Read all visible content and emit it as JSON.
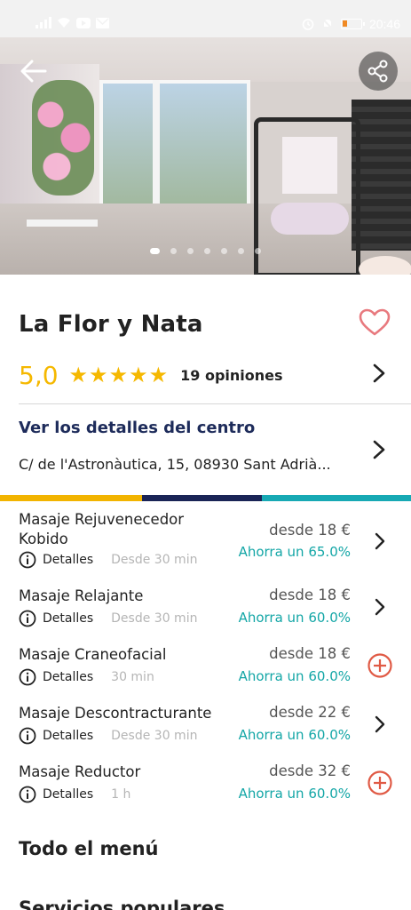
{
  "status_bar": {
    "time": "20:46",
    "battery_level": 0.2
  },
  "carousel": {
    "slide_count": 7,
    "active_index": 0
  },
  "business": {
    "name": "La Flor y Nata",
    "rating": "5,0",
    "stars": 5,
    "reviews_label": "19 opiniones",
    "details_label": "Ver los detalles del centro",
    "address": "C/ de l'Astronàutica, 15, 08930 Sant Adrià..."
  },
  "colors": {
    "accent_yellow": "#f2b400",
    "accent_navy": "#1a2456",
    "accent_teal": "#17a9b4",
    "add_button": "#e05a45",
    "heart": "#e8797e"
  },
  "services": [
    {
      "name": "Masaje Rejuvenecedor Kobido",
      "detail_label": "Detalles",
      "duration": "Desde 30 min",
      "price": "desde 18 €",
      "saving": "Ahorra un 65.0%",
      "action": "chevron"
    },
    {
      "name": "Masaje Relajante",
      "detail_label": "Detalles",
      "duration": "Desde 30 min",
      "price": "desde 18 €",
      "saving": "Ahorra un 60.0%",
      "action": "chevron"
    },
    {
      "name": "Masaje Craneofacial",
      "detail_label": "Detalles",
      "duration": "30 min",
      "price": "desde 18 €",
      "saving": "Ahorra un 60.0%",
      "action": "add"
    },
    {
      "name": "Masaje Descontracturante",
      "detail_label": "Detalles",
      "duration": "Desde 30 min",
      "price": "desde 22 €",
      "saving": "Ahorra un 60.0%",
      "action": "chevron"
    },
    {
      "name": "Masaje Reductor",
      "detail_label": "Detalles",
      "duration": "1 h",
      "price": "desde 32 €",
      "saving": "Ahorra un 60.0%",
      "action": "add"
    }
  ],
  "sections": {
    "menu_title": "Todo el menú",
    "popular_title": "Servicios populares"
  }
}
